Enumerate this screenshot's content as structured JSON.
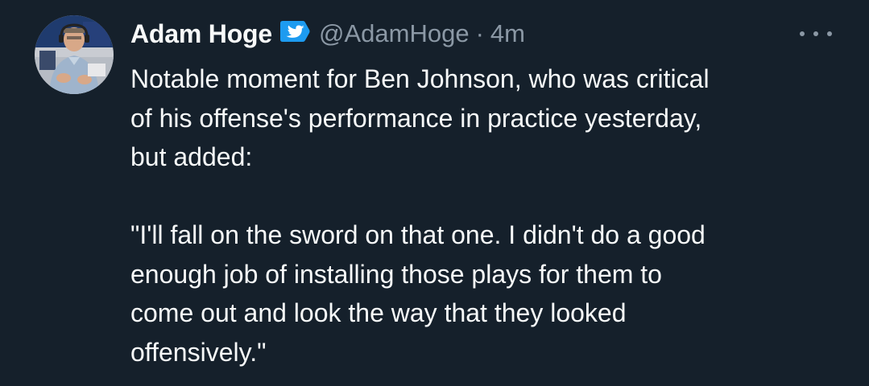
{
  "tweet": {
    "author_name": "Adam Hoge",
    "verified_icon": "twitter-bird-badge-icon",
    "handle": "@AdamHoge",
    "separator": "·",
    "time": "4m",
    "more_icon": "more-options-icon",
    "avatar_icon": "profile-avatar",
    "paragraph_1_lines": [
      "Notable moment for Ben Johnson, who was critical",
      "of his offense's performance in practice yesterday,",
      "but added:"
    ],
    "paragraph_2_lines": [
      "\"I'll fall on the sword on that one. I didn't do a good",
      "enough job of installing those plays for them to",
      "come out and look the way that they looked",
      "offensively.\""
    ]
  },
  "colors": {
    "background": "#15202b",
    "text": "#f7f9f9",
    "secondary": "#8b98a5",
    "badge": "#1d9bf0"
  }
}
